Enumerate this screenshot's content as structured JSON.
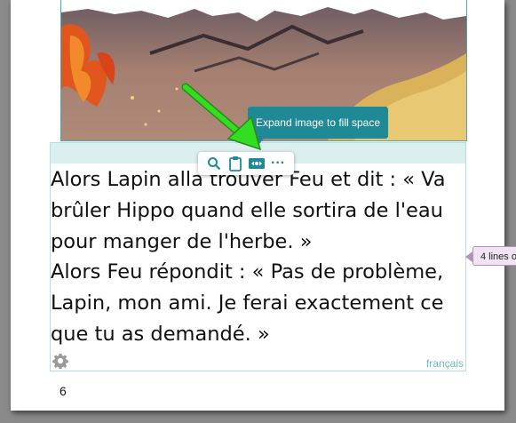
{
  "image": {
    "description_icon": "illustration-image"
  },
  "toolbar": {
    "icons": [
      "search-icon",
      "clipboard-icon",
      "expand-image-icon",
      "more-icon"
    ],
    "more_label": "···"
  },
  "tooltip": {
    "text": "Expand image to fill space"
  },
  "story": {
    "paragraphs": [
      "Alors Lapin alla trouver Feu et dit : « Va brûler Hippo quand elle sortira de l'eau pour manger de l'herbe. »",
      "Alors Feu répondit : « Pas de problème, Lapin, mon ami. Je ferai exactement ce que tu as demandé. »"
    ]
  },
  "language_label": "français",
  "side_bubble": {
    "text": "4 lines o"
  },
  "page_number": "6",
  "colors": {
    "accent": "#1f8a96",
    "frame_border": "#4aa8b0",
    "annotation_arrow": "#33dd22"
  }
}
